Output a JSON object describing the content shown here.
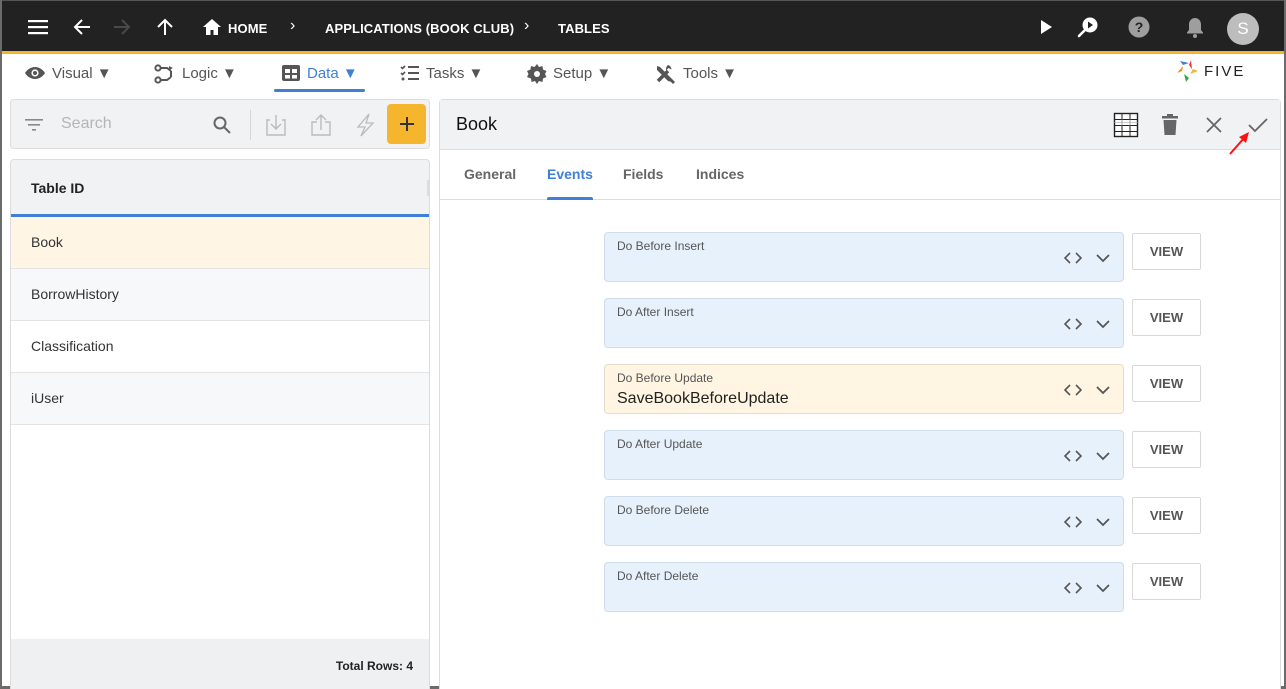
{
  "topbar": {
    "breadcrumbs": [
      {
        "label": "HOME",
        "icon": "home-icon"
      },
      {
        "label": "APPLICATIONS (BOOK CLUB)"
      },
      {
        "label": "TABLES"
      }
    ],
    "avatar_initial": "S",
    "icons": [
      "menu-icon",
      "back-arrow-icon",
      "forward-arrow-icon",
      "up-arrow-icon",
      "play-icon",
      "search-play-icon",
      "help-icon",
      "bell-icon"
    ]
  },
  "menu": {
    "items": [
      {
        "label": "Visual ▼",
        "icon": "eye-icon"
      },
      {
        "label": "Logic ▼",
        "icon": "logic-icon"
      },
      {
        "label": "Data ▼",
        "icon": "table-grid-icon",
        "active": true
      },
      {
        "label": "Tasks ▼",
        "icon": "checklist-icon"
      },
      {
        "label": "Setup ▼",
        "icon": "gear-icon"
      },
      {
        "label": "Tools ▼",
        "icon": "tools-icon"
      }
    ],
    "logo_text": "FIVE"
  },
  "left": {
    "search_placeholder": "Search",
    "column_header": "Table ID",
    "rows": [
      "Book",
      "BorrowHistory",
      "Classification",
      "iUser"
    ],
    "selected_row": "Book",
    "footer": "Total Rows: 4"
  },
  "detail": {
    "title": "Book",
    "tabs": [
      "General",
      "Events",
      "Fields",
      "Indices"
    ],
    "active_tab": "Events",
    "view_label": "VIEW",
    "events": [
      {
        "label": "Do Before Insert",
        "value": ""
      },
      {
        "label": "Do After Insert",
        "value": ""
      },
      {
        "label": "Do Before Update",
        "value": "SaveBookBeforeUpdate"
      },
      {
        "label": "Do After Update",
        "value": ""
      },
      {
        "label": "Do Before Delete",
        "value": ""
      },
      {
        "label": "Do After Delete",
        "value": ""
      }
    ]
  },
  "colors": {
    "topbar": "#222222",
    "accent_yellow": "#f5b52c",
    "accent_blue": "#3f7fd6",
    "field_bg": "#e7f1fb",
    "field_filled_bg": "#fff5e2",
    "annotation_arrow": "#ff1010"
  }
}
